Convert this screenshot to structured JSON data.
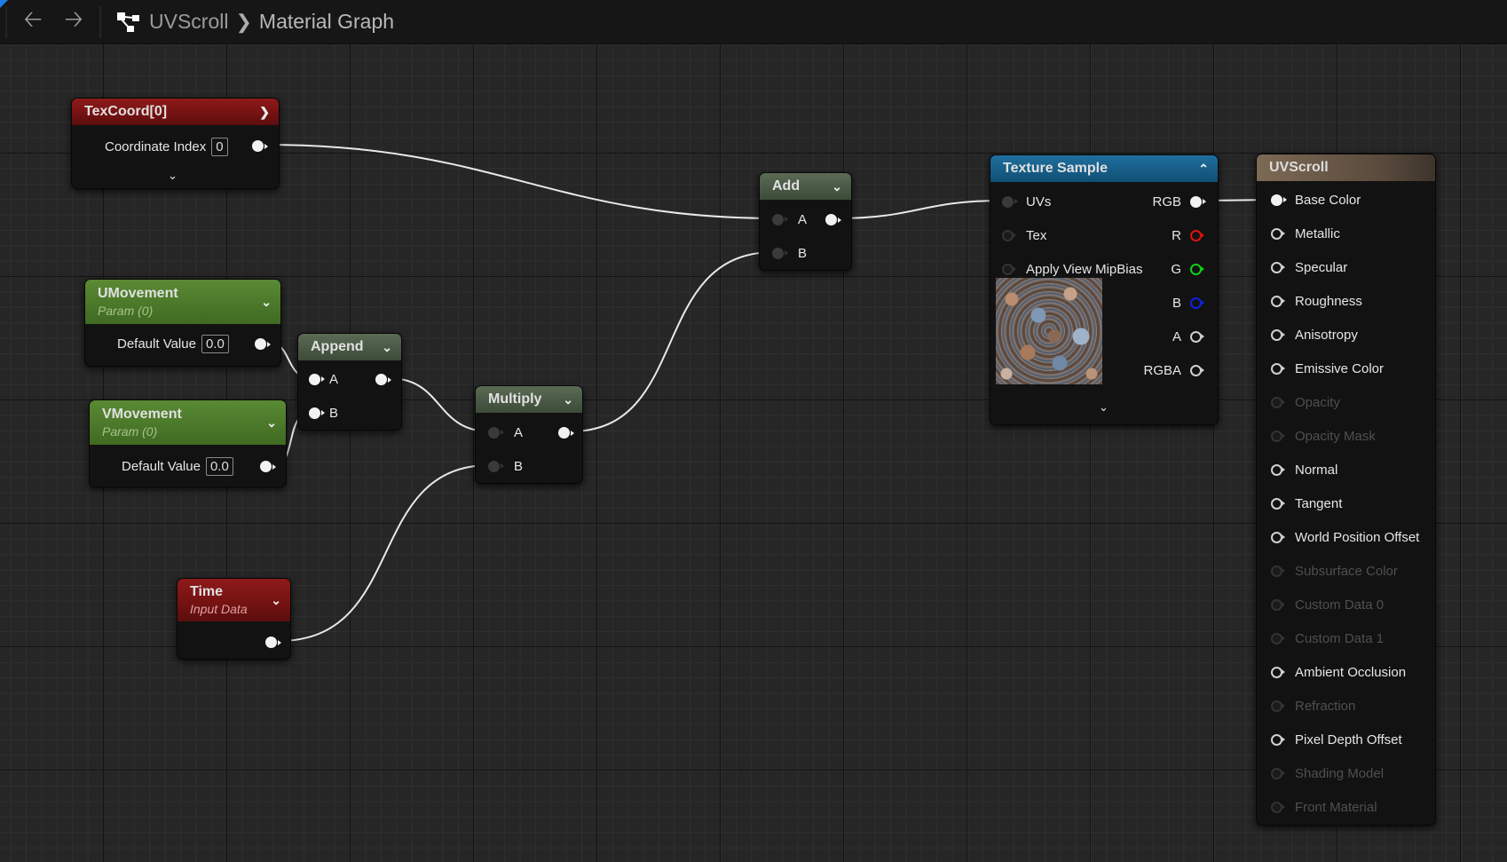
{
  "header": {
    "back_icon": "arrow-left-icon",
    "forward_icon": "arrow-right-icon",
    "graph_icon": "graph-icon",
    "breadcrumb": [
      "UVScroll",
      "Material Graph"
    ]
  },
  "nodes": {
    "texcoord": {
      "title": "TexCoord[0]",
      "row_label": "Coordinate Index",
      "value": "0",
      "color": "#8e1a1a"
    },
    "umovement": {
      "title": "UMovement",
      "subtitle": "Param (0)",
      "row_label": "Default Value",
      "value": "0.0"
    },
    "vmovement": {
      "title": "VMovement",
      "subtitle": "Param (0)",
      "row_label": "Default Value",
      "value": "0.0"
    },
    "append": {
      "title": "Append",
      "inputs": [
        "A",
        "B"
      ]
    },
    "multiply": {
      "title": "Multiply",
      "inputs": [
        "A",
        "B"
      ]
    },
    "time": {
      "title": "Time",
      "subtitle": "Input Data"
    },
    "add": {
      "title": "Add",
      "inputs": [
        "A",
        "B"
      ]
    },
    "texture_sample": {
      "title": "Texture Sample",
      "inputs": [
        "UVs",
        "Tex",
        "Apply View MipBias"
      ],
      "outputs": [
        "RGB",
        "R",
        "G",
        "B",
        "A",
        "RGBA"
      ],
      "output_colors": [
        "#f2f2f2",
        "#e01010",
        "#10d010",
        "#1020e0",
        "#cfcfcf",
        "#cfcfcf"
      ]
    },
    "result": {
      "title": "UVScroll",
      "inputs": [
        {
          "label": "Base Color",
          "enabled": true
        },
        {
          "label": "Metallic",
          "enabled": true
        },
        {
          "label": "Specular",
          "enabled": true
        },
        {
          "label": "Roughness",
          "enabled": true
        },
        {
          "label": "Anisotropy",
          "enabled": true
        },
        {
          "label": "Emissive Color",
          "enabled": true
        },
        {
          "label": "Opacity",
          "enabled": false
        },
        {
          "label": "Opacity Mask",
          "enabled": false
        },
        {
          "label": "Normal",
          "enabled": true
        },
        {
          "label": "Tangent",
          "enabled": true
        },
        {
          "label": "World Position Offset",
          "enabled": true
        },
        {
          "label": "Subsurface Color",
          "enabled": false
        },
        {
          "label": "Custom Data 0",
          "enabled": false
        },
        {
          "label": "Custom Data 1",
          "enabled": false
        },
        {
          "label": "Ambient Occlusion",
          "enabled": true
        },
        {
          "label": "Refraction",
          "enabled": false
        },
        {
          "label": "Pixel Depth Offset",
          "enabled": true
        },
        {
          "label": "Shading Model",
          "enabled": false
        },
        {
          "label": "Front Material",
          "enabled": false
        }
      ]
    }
  }
}
